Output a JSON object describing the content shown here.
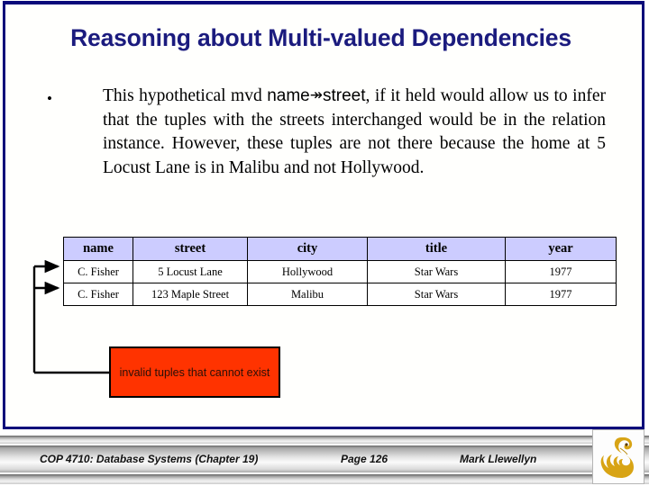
{
  "slide": {
    "title": "Reasoning about Multi-valued Dependencies",
    "accent_navy": "#1b1b7e",
    "frame_border_color": "#0a0a7a",
    "background": "#ffffff"
  },
  "bullet": {
    "marker": "•",
    "text_part_1": "This hypothetical mvd ",
    "term_left": "name",
    "arrow": "↠",
    "term_right": "street",
    "text_part_2": ", if it held would allow us to infer that the tuples with the streets interchanged would be in the relation instance.  However, these tuples are not there because the home at 5 Locust Lane is in Malibu and not Hollywood."
  },
  "table": {
    "header_background": "#ccccff",
    "columns": [
      "name",
      "street",
      "city",
      "title",
      "year"
    ],
    "rows": [
      [
        "C. Fisher",
        "5 Locust Lane",
        "Hollywood",
        "Star Wars",
        "1977"
      ],
      [
        "C. Fisher",
        "123 Maple Street",
        "Malibu",
        "Star Wars",
        "1977"
      ]
    ]
  },
  "annotation": {
    "invalid_box_label": "invalid tuples that cannot exist",
    "box_fill": "#ff3300",
    "box_border": "#000000"
  },
  "footer": {
    "course": "COP 4710: Database Systems  (Chapter 19)",
    "page": "Page 126",
    "author": "Mark Llewellyn",
    "logo_name": "ucf-pegasus-logo",
    "logo_color": "#d8a415"
  }
}
